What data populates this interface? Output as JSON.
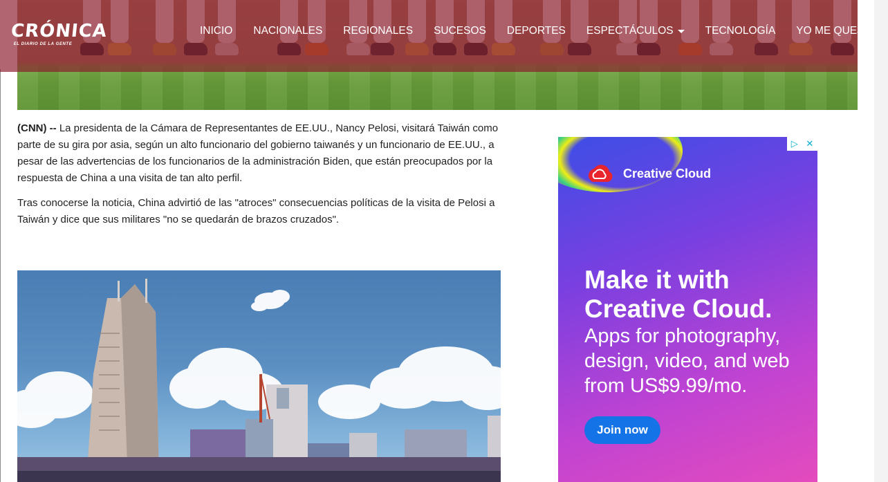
{
  "header": {
    "logo_name": "CRÓNICA",
    "logo_tagline": "EL DIARIO DE LA GENTE",
    "nav_items": [
      "INICIO",
      "NACIONALES",
      "REGIONALES",
      "SUCESOS",
      "DEPORTES",
      "ESPECTÁCULOS",
      "TECNOLOGÍA",
      "YO ME QUEJO"
    ]
  },
  "article": {
    "source": "(CNN) --",
    "paragraph1": "La presidenta de la Cámara de Representantes de EE.UU., Nancy Pelosi, visitará Taiwán como parte de su gira por asia, según un alto funcionario del gobierno taiwanés y un funcionario de EE.UU., a pesar de las advertencias de los funcionarios de la administración Biden, que están preocupados por la respuesta de China a una visita de tan alto perfil.",
    "paragraph2": "Tras conocerse la noticia, China advirtió de las \"atroces\" consecuencias políticas de la visita de Pelosi a Taiwán y dice que sus militares \"no se quedarán de brazos cruzados\"."
  },
  "ad": {
    "brand": "Creative Cloud",
    "headline_line1": "Make it with",
    "headline_line2": "Creative Cloud.",
    "sub_line1": "Apps for photography,",
    "sub_line2": "design, video, and web",
    "sub_line3": "from US$9.99/mo.",
    "button": "Join now",
    "badge_icons": [
      "adchoices-icon",
      "close-icon"
    ]
  },
  "colors": {
    "navbar": "#8a1c2c",
    "ad_button": "#1473e6"
  }
}
